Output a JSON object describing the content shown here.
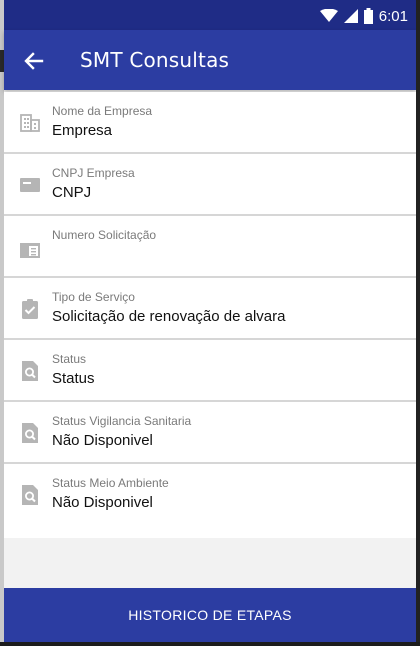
{
  "status_bar": {
    "time": "6:01",
    "icons": [
      "wifi-icon",
      "cell-signal-icon",
      "battery-icon"
    ]
  },
  "app_bar": {
    "back_icon": "arrow-left-icon",
    "title": "SMT Consultas"
  },
  "fields": [
    {
      "icon": "building-icon",
      "label": "Nome da Empresa",
      "value": "Empresa"
    },
    {
      "icon": "card-icon",
      "label": "CNPJ Empresa",
      "value": "CNPJ"
    },
    {
      "icon": "document-icon",
      "label": "Numero Solicitação",
      "value": ""
    },
    {
      "icon": "clipboard-check-icon",
      "label": "Tipo de Serviço",
      "value": "Solicitação de renovação de alvara"
    },
    {
      "icon": "search-document-icon",
      "label": "Status",
      "value": "Status"
    },
    {
      "icon": "search-document-icon",
      "label": "Status Vigilancia Sanitaria",
      "value": "Não Disponivel"
    },
    {
      "icon": "search-document-icon",
      "label": "Status Meio Ambiente",
      "value": "Não Disponivel"
    }
  ],
  "footer": {
    "button_label": "HISTORICO DE ETAPAS"
  },
  "colors": {
    "primary": "#2c3da2",
    "status_bar": "#1f2c86",
    "icon": "#b5b5b5",
    "divider": "#d6d6d6"
  }
}
